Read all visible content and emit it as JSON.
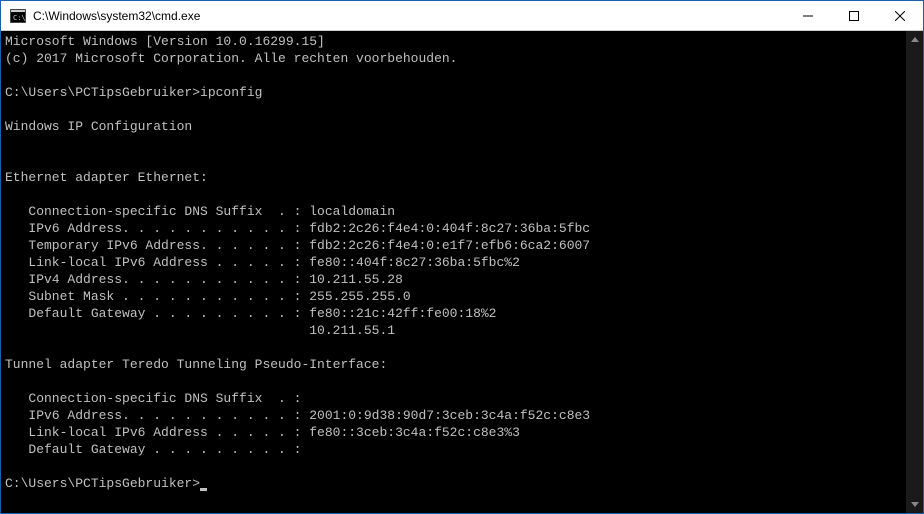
{
  "window": {
    "title": "C:\\Windows\\system32\\cmd.exe"
  },
  "console": {
    "line_version": "Microsoft Windows [Version 10.0.16299.15]",
    "line_copyright": "(c) 2017 Microsoft Corporation. Alle rechten voorbehouden.",
    "prompt1": "C:\\Users\\PCTipsGebruiker>ipconfig",
    "header": "Windows IP Configuration",
    "adapter1_title": "Ethernet adapter Ethernet:",
    "a1_dns": "   Connection-specific DNS Suffix  . : localdomain",
    "a1_ipv6": "   IPv6 Address. . . . . . . . . . . : fdb2:2c26:f4e4:0:404f:8c27:36ba:5fbc",
    "a1_tmp_ipv6": "   Temporary IPv6 Address. . . . . . : fdb2:2c26:f4e4:0:e1f7:efb6:6ca2:6007",
    "a1_link_local": "   Link-local IPv6 Address . . . . . : fe80::404f:8c27:36ba:5fbc%2",
    "a1_ipv4": "   IPv4 Address. . . . . . . . . . . : 10.211.55.28",
    "a1_subnet": "   Subnet Mask . . . . . . . . . . . : 255.255.255.0",
    "a1_gateway": "   Default Gateway . . . . . . . . . : fe80::21c:42ff:fe00:18%2",
    "a1_gateway2": "                                       10.211.55.1",
    "adapter2_title": "Tunnel adapter Teredo Tunneling Pseudo-Interface:",
    "a2_dns": "   Connection-specific DNS Suffix  . :",
    "a2_ipv6": "   IPv6 Address. . . . . . . . . . . : 2001:0:9d38:90d7:3ceb:3c4a:f52c:c8e3",
    "a2_link_local": "   Link-local IPv6 Address . . . . . : fe80::3ceb:3c4a:f52c:c8e3%3",
    "a2_gateway": "   Default Gateway . . . . . . . . . :",
    "prompt2": "C:\\Users\\PCTipsGebruiker>"
  }
}
